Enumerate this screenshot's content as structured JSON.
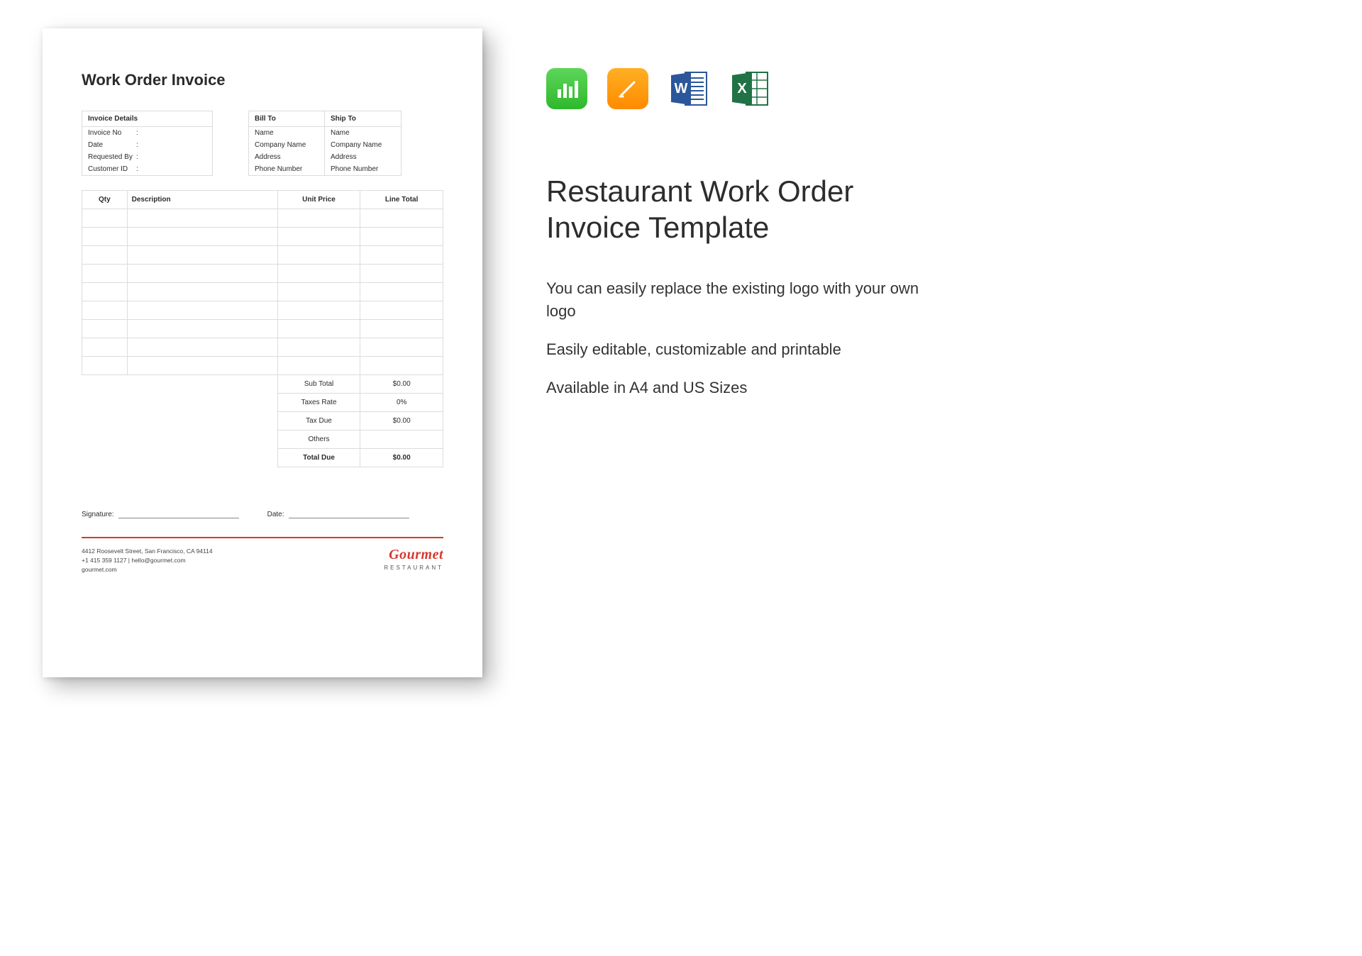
{
  "document": {
    "title": "Work Order Invoice",
    "invoice_details_header": "Invoice Details",
    "invoice_fields": [
      "Invoice No",
      "Date",
      "Requested By",
      "Customer ID"
    ],
    "bill_to_header": "Bill To",
    "ship_to_header": "Ship To",
    "party_rows": [
      "Name",
      "Company Name",
      "Address",
      "Phone Number"
    ],
    "table_headers": {
      "qty": "Qty",
      "desc": "Description",
      "unit": "Unit Price",
      "line": "Line Total"
    },
    "empty_rows": 9,
    "totals": [
      {
        "label": "Sub Total",
        "value": "$0.00",
        "bold": false
      },
      {
        "label": "Taxes Rate",
        "value": "0%",
        "bold": false
      },
      {
        "label": "Tax Due",
        "value": "$0.00",
        "bold": false
      },
      {
        "label": "Others",
        "value": "",
        "bold": false
      },
      {
        "label": "Total Due",
        "value": "$0.00",
        "bold": true
      }
    ],
    "signature_label": "Signature:",
    "date_label": "Date:",
    "footer": {
      "address": "4412 Roosevelt Street, San Francisco, CA 94114",
      "contact": "+1 415 359 1127 | hello@gourmet.com",
      "website": "gourmet.com"
    },
    "brand": {
      "name": "Gourmet",
      "sub": "RESTAURANT"
    }
  },
  "product": {
    "icons": [
      "numbers-icon",
      "pages-icon",
      "word-icon",
      "excel-icon"
    ],
    "title_line1": "Restaurant Work Order",
    "title_line2": "Invoice Template",
    "features": [
      "You can easily replace the existing logo with your own logo",
      "Easily editable, customizable and printable",
      "Available in A4 and US Sizes"
    ]
  }
}
